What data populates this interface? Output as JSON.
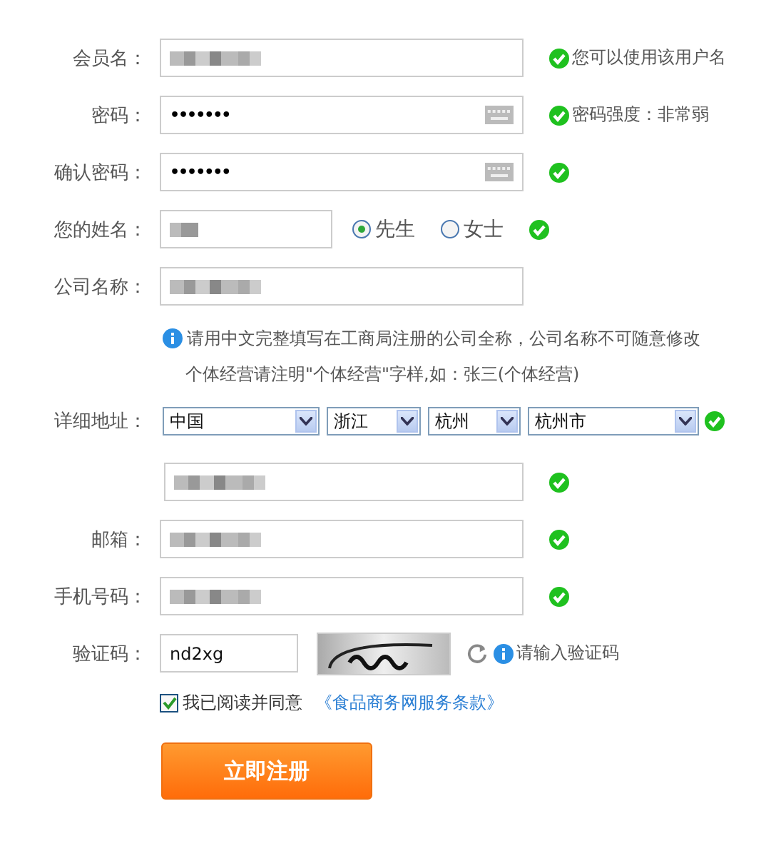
{
  "rows": [
    {
      "kind": "text",
      "label": "会员名：",
      "blurred": true,
      "ok": true,
      "status": "您可以使用该用户名"
    },
    {
      "kind": "password",
      "label": "密码：",
      "value": "•••••••",
      "ok": true,
      "status": "密码强度：非常弱"
    },
    {
      "kind": "password",
      "label": "确认密码：",
      "value": "•••••••",
      "ok": true
    },
    {
      "kind": "name",
      "label": "您的姓名：",
      "blurred": true,
      "ok": true,
      "options": [
        {
          "label": "先生",
          "selected": true
        },
        {
          "label": "女士",
          "selected": false
        }
      ]
    },
    {
      "kind": "text",
      "label": "公司名称：",
      "blurred": true,
      "hint": [
        "请用中文完整填写在工商局注册的公司全称，公司名称不可随意修改",
        "个体经营请注明\"个体经营\"字样,如：张三(个体经营)"
      ]
    },
    {
      "kind": "address",
      "label": "详细地址：",
      "ok": true,
      "selects": [
        "中国",
        "浙江",
        "杭州",
        "杭州市"
      ]
    },
    {
      "kind": "text",
      "blurred": true,
      "ok": true
    },
    {
      "kind": "text",
      "label": "邮箱：",
      "blurred": true,
      "ok": true
    },
    {
      "kind": "text",
      "label": "手机号码：",
      "blurred": true,
      "ok": true
    },
    {
      "kind": "captcha",
      "label": "验证码：",
      "value": "nd2xg",
      "status": "请输入验证码"
    }
  ],
  "agreement": {
    "checked": true,
    "text": "我已阅读并同意",
    "link": "《食品商务网服务条款》"
  },
  "submit": "立即注册"
}
